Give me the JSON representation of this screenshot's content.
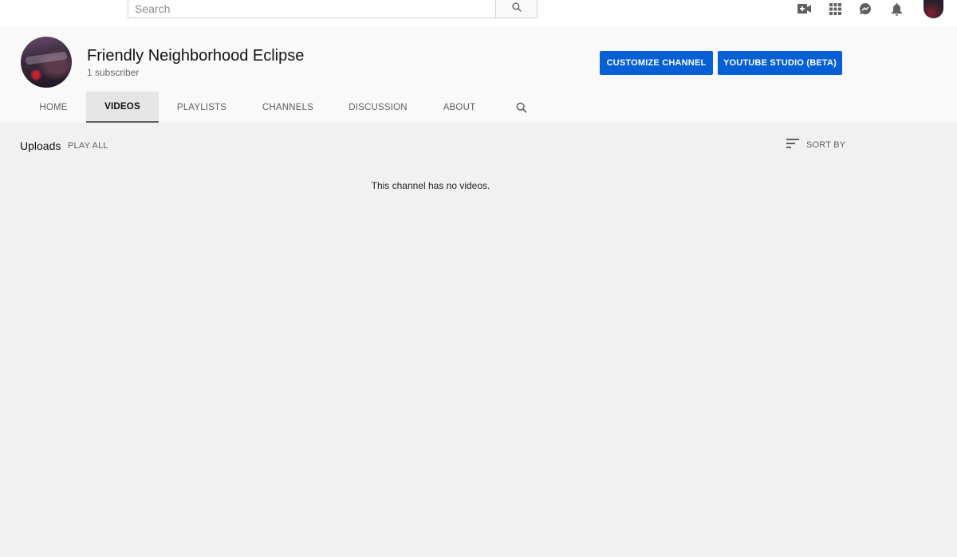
{
  "topbar": {
    "search_placeholder": "Search",
    "icons": [
      "search-icon",
      "create-video-icon",
      "apps-grid-icon",
      "messages-icon",
      "notifications-bell-icon",
      "account-avatar"
    ]
  },
  "channel": {
    "name": "Friendly Neighborhood Eclipse",
    "subscribers": "1 subscriber",
    "customize_label": "CUSTOMIZE CHANNEL",
    "studio_label": "YOUTUBE STUDIO (BETA)"
  },
  "tabs": {
    "home": "HOME",
    "videos": "VIDEOS",
    "playlists": "PLAYLISTS",
    "channels": "CHANNELS",
    "discussion": "DISCUSSION",
    "about": "ABOUT",
    "active": "VIDEOS"
  },
  "content": {
    "section_title": "Uploads",
    "play_all": "PLAY ALL",
    "sort_by": "SORT BY",
    "empty_message": "This channel has no videos."
  },
  "colors": {
    "accent_blue": "#065fd4",
    "page_bg": "#f1f1f1",
    "header_bg": "#f9f9f9"
  }
}
